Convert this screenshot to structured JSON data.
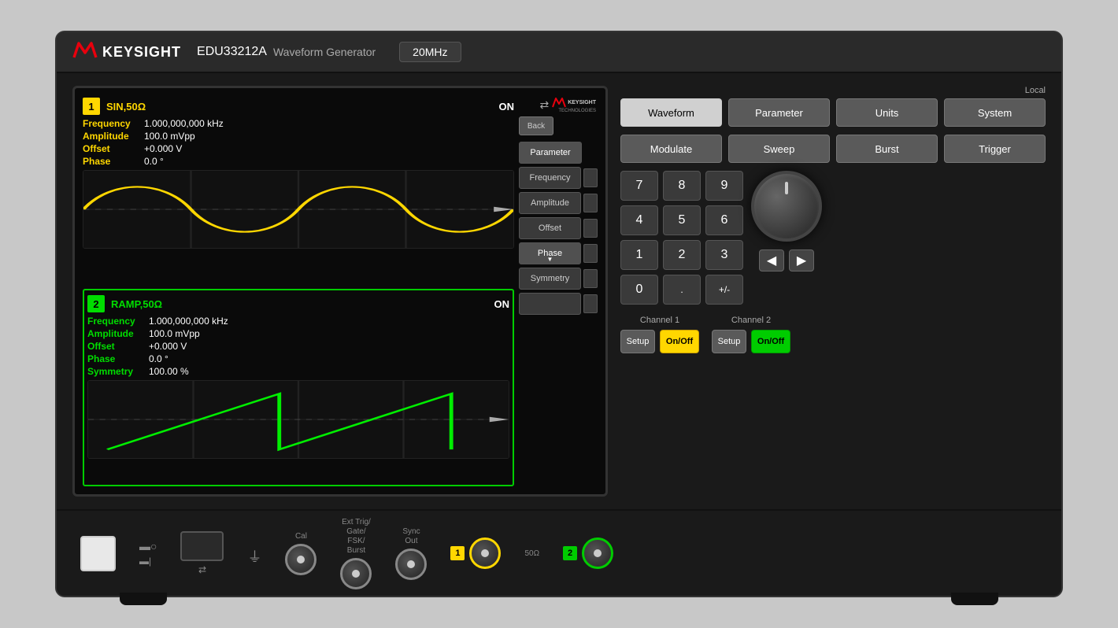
{
  "instrument": {
    "brand": "KEYSIGHT",
    "model": "EDU33212A",
    "type": "Waveform Generator",
    "frequency": "20MHz"
  },
  "channel1": {
    "number": "1",
    "type": "SIN,50Ω",
    "status": "ON",
    "params": {
      "frequency": {
        "label": "Frequency",
        "value": "1.000,000,000 kHz"
      },
      "amplitude": {
        "label": "Amplitude",
        "value": "100.0 mVpp"
      },
      "offset": {
        "label": "Offset",
        "value": "+0.000 V"
      },
      "phase": {
        "label": "Phase",
        "value": "0.0 °"
      }
    }
  },
  "channel2": {
    "number": "2",
    "type": "RAMP,50Ω",
    "status": "ON",
    "params": {
      "frequency": {
        "label": "Frequency",
        "value": "1.000,000,000 kHz"
      },
      "amplitude": {
        "label": "Amplitude",
        "value": "100.0 mVpp"
      },
      "offset": {
        "label": "Offset",
        "value": "+0.000 V"
      },
      "phase": {
        "label": "Phase",
        "value": "0.0 °"
      },
      "symmetry": {
        "label": "Symmetry",
        "value": "100.00 %"
      }
    }
  },
  "menu": {
    "parameter_label": "Parameter",
    "frequency_label": "Frequency",
    "amplitude_label": "Amplitude",
    "offset_label": "Offset",
    "phase_label": "Phase",
    "symmetry_label": "Symmetry",
    "back_label": "Back"
  },
  "top_buttons": {
    "waveform": "Waveform",
    "parameter": "Parameter",
    "units": "Units",
    "system": "System",
    "modulate": "Modulate",
    "sweep": "Sweep",
    "burst": "Burst",
    "trigger": "Trigger"
  },
  "numpad": {
    "keys": [
      "7",
      "8",
      "9",
      "4",
      "5",
      "6",
      "1",
      "2",
      "3",
      "0",
      ".",
      "+/-"
    ]
  },
  "channel_controls": {
    "ch1_label": "Channel 1",
    "ch2_label": "Channel 2",
    "setup_label": "Setup",
    "onoff_label": "On/Off"
  },
  "bottom": {
    "cal_label": "Cal",
    "ext_trig_label": "Ext Trig/\nGate/\nFSK/\nBurst",
    "sync_out_label": "Sync\nOut",
    "ohm_label": "50Ω"
  },
  "local_label": "Local"
}
